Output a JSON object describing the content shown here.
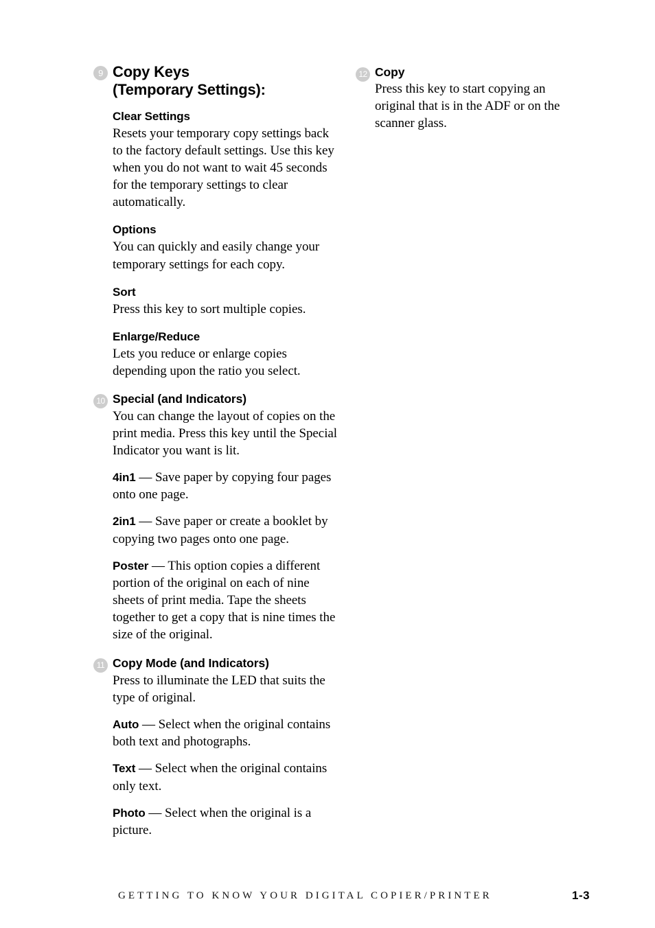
{
  "document": {
    "page_number": "1-3",
    "footer_running_head": "GETTING TO KNOW YOUR DIGITAL COPIER/PRINTER"
  },
  "left_column": {
    "section_9": {
      "number": "9",
      "title_line1": "Copy Keys",
      "title_line2": "(Temporary Settings):",
      "subsections": [
        {
          "heading": "Clear Settings",
          "body": "Resets your temporary copy settings back to the factory default settings. Use this key when you do not want to wait 45 seconds for the temporary settings to clear automatically."
        },
        {
          "heading": "Options",
          "body": "You can quickly and easily change your temporary settings for each copy."
        },
        {
          "heading": "Sort",
          "body": "Press this key to sort multiple copies."
        },
        {
          "heading": "Enlarge/Reduce",
          "body": "Lets you reduce or enlarge copies depending upon the ratio you select."
        }
      ]
    },
    "section_10": {
      "number": "10",
      "heading": "Special (and Indicators)",
      "body": "You can change the layout of copies on the print media. Press this key until the Special Indicator you want is lit.",
      "terms": [
        {
          "term": "4in1",
          "dash": " — ",
          "description": "Save paper by copying four pages onto one page."
        },
        {
          "term": "2in1",
          "dash": " — ",
          "description": "Save paper or create a booklet by copying two pages onto one page."
        },
        {
          "term": "Poster",
          "dash": " — ",
          "description": "This option copies a different portion of the original on each of nine sheets of print media. Tape the sheets together to get a copy that is nine times the size of the original."
        }
      ]
    },
    "section_11": {
      "number": "11",
      "heading": "Copy Mode (and Indicators)",
      "body": "Press to illuminate the LED that suits the type of original.",
      "terms": [
        {
          "term": "Auto",
          "dash": " — ",
          "description": "Select when the original contains both text and photographs."
        },
        {
          "term": "Text",
          "dash": " — ",
          "description": "Select when the original contains only text."
        },
        {
          "term": "Photo",
          "dash": " — ",
          "description": "Select when the original is a picture."
        }
      ]
    }
  },
  "right_column": {
    "section_12": {
      "number": "12",
      "heading": "Copy",
      "body": "Press this key to start copying an original that is in the ADF or on the scanner glass."
    }
  }
}
